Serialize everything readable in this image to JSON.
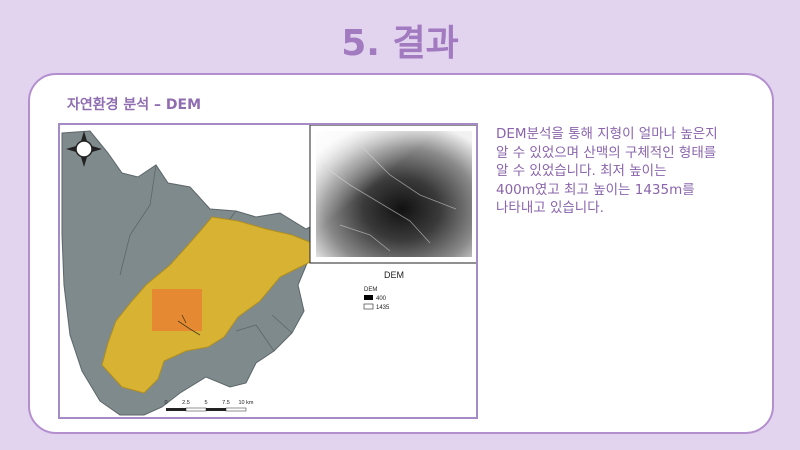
{
  "slide": {
    "title": "5. 결과"
  },
  "section": {
    "heading": "자연환경 분석 – DEM"
  },
  "map": {
    "inset_title": "DEM",
    "legend": {
      "title": "DEM",
      "low_label": "400",
      "high_label": "1435",
      "low_color": "#000000",
      "high_color": "#ffffff"
    },
    "scale_bar": {
      "ticks": [
        "0",
        "2.5",
        "5",
        "7.5",
        "10 km"
      ]
    },
    "colors": {
      "region_fill": "#7f8a8d",
      "highlight_fill": "#d8b333",
      "focus_fill": "#e58a32"
    },
    "north_arrow_icon": "compass-rose-icon"
  },
  "description": {
    "text": "DEM분석을 통해 지형이 얼마나 높은지 알 수 있었으며 산맥의 구체적인 형태를 알 수 있었습니다. 최저 높이는 400m였고 최고 높이는 1435m를 나타내고 있습니다."
  }
}
